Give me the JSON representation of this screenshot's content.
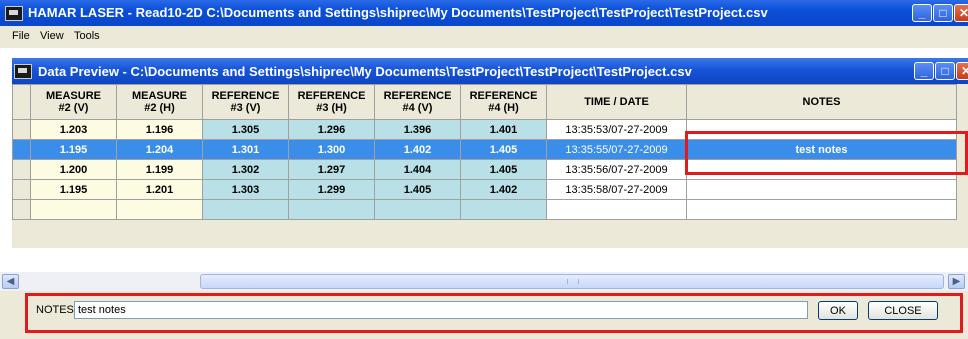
{
  "window": {
    "title": "HAMAR LASER - Read10-2D C:\\Documents and Settings\\shiprec\\My Documents\\TestProject\\TestProject\\TestProject.csv"
  },
  "menu": {
    "items": [
      "File",
      "View",
      "Tools"
    ]
  },
  "preview": {
    "title": "Data Preview - C:\\Documents and Settings\\shiprec\\My Documents\\TestProject\\TestProject\\TestProject.csv",
    "headers": [
      [
        "MEASURE",
        "#2 (V)"
      ],
      [
        "MEASURE",
        "#2 (H)"
      ],
      [
        "REFERENCE",
        "#3 (V)"
      ],
      [
        "REFERENCE",
        "#3 (H)"
      ],
      [
        "REFERENCE",
        "#4 (V)"
      ],
      [
        "REFERENCE",
        "#4 (H)"
      ],
      [
        "TIME / DATE",
        ""
      ],
      [
        "NOTES",
        ""
      ]
    ],
    "rows": [
      [
        "1.203",
        "1.196",
        "1.305",
        "1.296",
        "1.396",
        "1.401",
        "13:35:53/07-27-2009",
        ""
      ],
      [
        "1.195",
        "1.204",
        "1.301",
        "1.300",
        "1.402",
        "1.405",
        "13:35:55/07-27-2009",
        "test notes"
      ],
      [
        "1.200",
        "1.199",
        "1.302",
        "1.297",
        "1.404",
        "1.405",
        "13:35:56/07-27-2009",
        ""
      ],
      [
        "1.195",
        "1.201",
        "1.303",
        "1.299",
        "1.405",
        "1.402",
        "13:35:58/07-27-2009",
        ""
      ],
      [
        "",
        "",
        "",
        "",
        "",
        "",
        "",
        ""
      ]
    ],
    "selected_row": 1
  },
  "notes_panel": {
    "label": "NOTES:",
    "value": "test notes",
    "ok_label": "OK",
    "close_label": "CLOSE"
  },
  "colors": {
    "title_bar": "#0a4fd9",
    "measure_cells": "#fdfbe2",
    "reference_cells": "#b9e0e6",
    "selected_row": "#3a8eea",
    "highlight_box": "#e01b1b"
  },
  "icons": [
    "app-icon",
    "minimize-icon",
    "maximize-icon",
    "close-icon",
    "scroll-left-icon",
    "scroll-right-icon"
  ]
}
